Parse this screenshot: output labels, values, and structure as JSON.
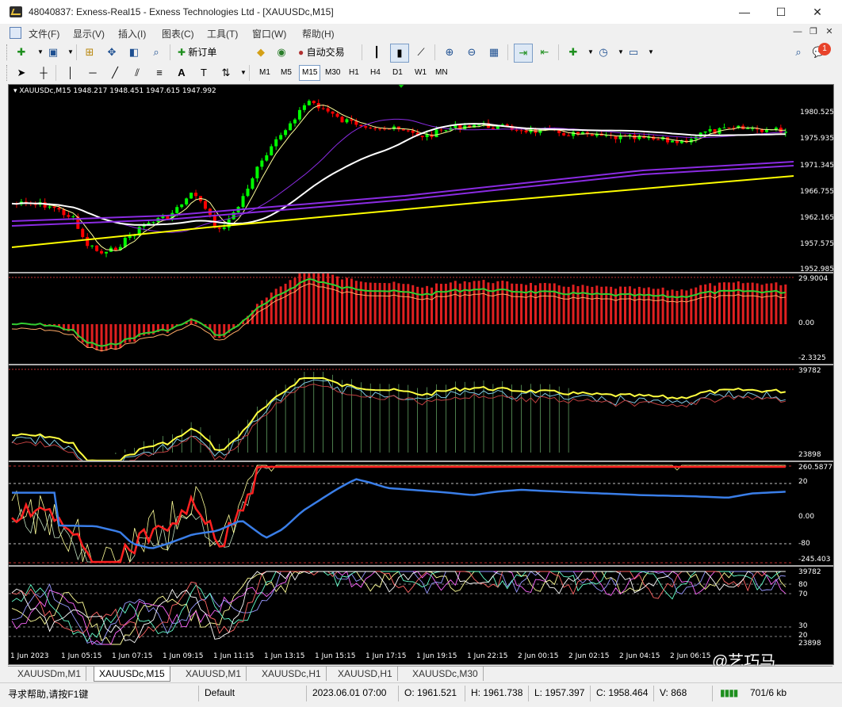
{
  "window": {
    "title": "48040837: Exness-Real15 - Exness Technologies Ltd - [XAUUSDc,M15]",
    "minimize": "—",
    "maximize": "☐",
    "close": "✕"
  },
  "menu": {
    "items": [
      "文件(F)",
      "显示(V)",
      "插入(I)",
      "图表(C)",
      "工具(T)",
      "窗口(W)",
      "帮助(H)"
    ],
    "mdi_buttons": [
      "—",
      "❐",
      "✕"
    ]
  },
  "toolbar": {
    "new_order_label": "新订单",
    "auto_trade_label": "自动交易",
    "notification_count": "1"
  },
  "timeframes": [
    "M1",
    "M5",
    "M15",
    "M30",
    "H1",
    "H4",
    "D1",
    "W1",
    "MN"
  ],
  "active_timeframe": "M15",
  "chart": {
    "symbol_info": "XAUUSDc,M15  1948.217 1948.451 1947.615 1947.992",
    "price_axis": [
      "1980.525",
      "1975.935",
      "1971.345",
      "1966.755",
      "1962.165",
      "1957.575",
      "1952.985"
    ],
    "pane2_axis": [
      "29.9004",
      "0.00",
      "-2.3325"
    ],
    "pane3_axis": [
      "39782",
      "23898"
    ],
    "pane4_axis": [
      "260.5877",
      "20",
      "0.00",
      "-80",
      "-245.403"
    ],
    "pane5_axis": [
      "39782",
      "80",
      "70",
      "30",
      "20",
      "23898"
    ],
    "time_axis": [
      "1 Jun 2023",
      "1 Jun 05:15",
      "1 Jun 07:15",
      "1 Jun 09:15",
      "1 Jun 11:15",
      "1 Jun 13:15",
      "1 Jun 15:15",
      "1 Jun 17:15",
      "1 Jun 19:15",
      "1 Jun 22:15",
      "2 Jun 00:15",
      "2 Jun 02:15",
      "2 Jun 04:15",
      "2 Jun 06:15"
    ],
    "colors": {
      "bull": "#00ff00",
      "bear": "#ff0000",
      "ma_fast": "#ffff99",
      "ma_mid": "#ffffff",
      "ma_slow": "#8a2be2",
      "ma_long": "#ffff00",
      "macd_signal": "#32cd32",
      "rsi_blue": "#3a7ee8"
    }
  },
  "tabs": [
    "XAUUSDm,M1",
    "XAUUSDc,M15",
    "XAUUSD,M1",
    "XAUUSDc,H1",
    "XAUUSD,H1",
    "XAUUSDc,M30"
  ],
  "active_tab": "XAUUSDc,M15",
  "status": {
    "help": "寻求帮助,请按F1键",
    "profile": "Default",
    "datetime": "2023.06.01 07:00",
    "open": "O: 1961.521",
    "high": "H: 1961.738",
    "low": "L: 1957.397",
    "close": "C: 1958.464",
    "volume": "V: 868",
    "traffic": "701/6 kb"
  },
  "watermark": "@艺巧马"
}
